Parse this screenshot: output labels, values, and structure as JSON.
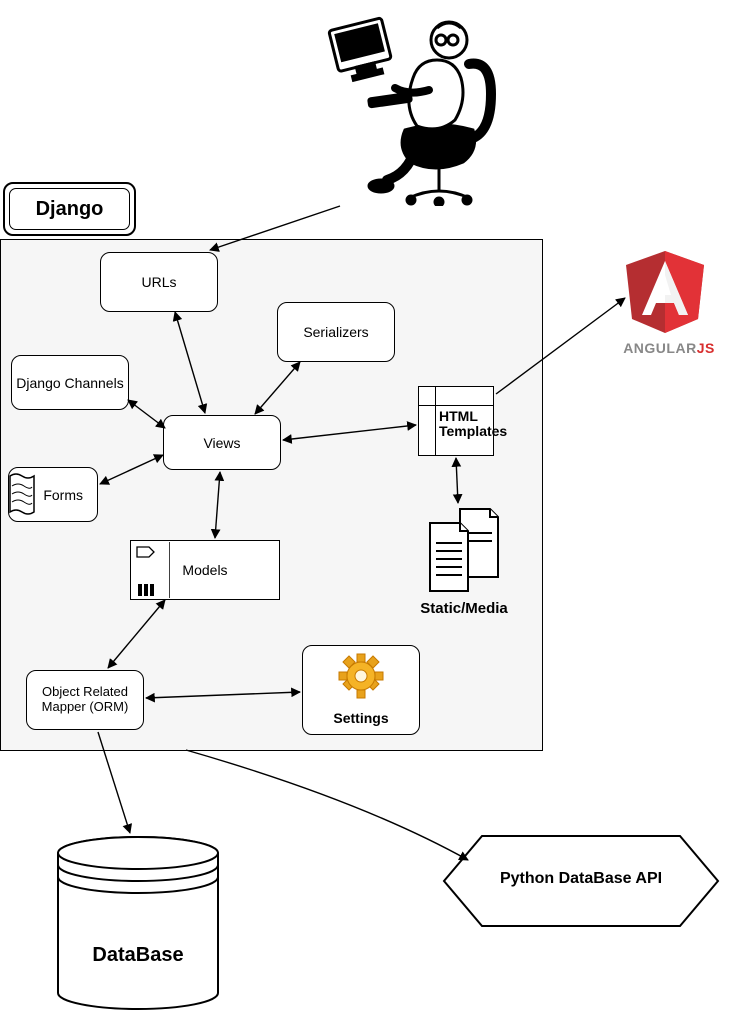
{
  "django": {
    "label": "Django",
    "urls": "URLs",
    "serializers": "Serializers",
    "channels": "Django Channels",
    "views": "Views",
    "forms": "Forms",
    "models": "Models",
    "orm": "Object Related Mapper (ORM)",
    "settings": "Settings",
    "html_templates_line1": "HTML",
    "html_templates_line2": "Templates",
    "static_media": "Static/Media"
  },
  "angular": {
    "name": "ANGULAR",
    "suffix": "JS"
  },
  "database": {
    "label": "DataBase"
  },
  "python_api": {
    "label": "Python DataBase API"
  }
}
